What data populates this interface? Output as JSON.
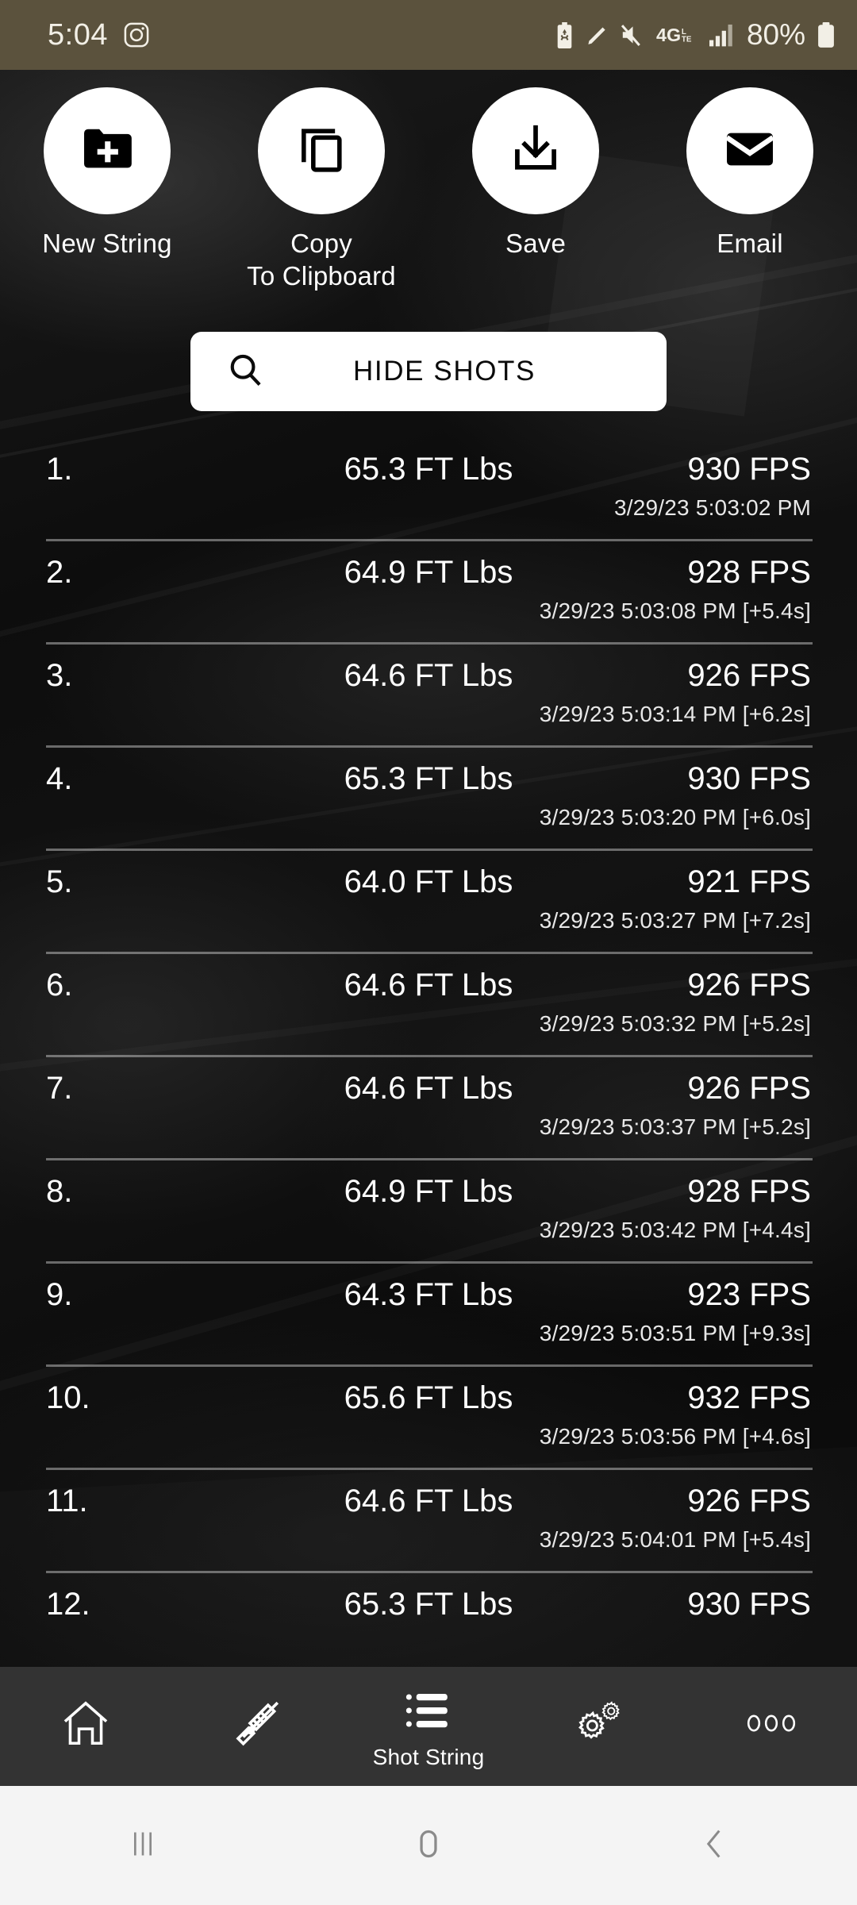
{
  "status_bar": {
    "time": "5:04",
    "battery_percent": "80%",
    "background_color": "#5b523d",
    "icons_left": [
      "instagram-icon"
    ],
    "icons_right": [
      "battery-saver-icon",
      "pencil-icon",
      "mute-icon",
      "4g-lte-icon",
      "signal-bars-icon",
      "battery-icon"
    ],
    "network": "4G",
    "network_sub": "LTE"
  },
  "actions": [
    {
      "label": "New String",
      "icon": "new-folder-icon"
    },
    {
      "label": "Copy\nTo Clipboard",
      "icon": "copy-icon"
    },
    {
      "label": "Save",
      "icon": "download-icon"
    },
    {
      "label": "Email",
      "icon": "envelope-icon"
    }
  ],
  "hide_shots": {
    "label": "HIDE SHOTS",
    "icon": "search-icon"
  },
  "shot_list": {
    "energy_unit": "FT Lbs",
    "speed_unit": "FPS",
    "rows": [
      {
        "index": "1.",
        "energy": "65.3 FT Lbs",
        "speed": "930 FPS",
        "timestamp": "3/29/23 5:03:02 PM"
      },
      {
        "index": "2.",
        "energy": "64.9 FT Lbs",
        "speed": "928 FPS",
        "timestamp": "3/29/23 5:03:08 PM [+5.4s]"
      },
      {
        "index": "3.",
        "energy": "64.6 FT Lbs",
        "speed": "926 FPS",
        "timestamp": "3/29/23 5:03:14 PM [+6.2s]"
      },
      {
        "index": "4.",
        "energy": "65.3 FT Lbs",
        "speed": "930 FPS",
        "timestamp": "3/29/23 5:03:20 PM [+6.0s]"
      },
      {
        "index": "5.",
        "energy": "64.0 FT Lbs",
        "speed": "921 FPS",
        "timestamp": "3/29/23 5:03:27 PM [+7.2s]"
      },
      {
        "index": "6.",
        "energy": "64.6 FT Lbs",
        "speed": "926 FPS",
        "timestamp": "3/29/23 5:03:32 PM [+5.2s]"
      },
      {
        "index": "7.",
        "energy": "64.6 FT Lbs",
        "speed": "926 FPS",
        "timestamp": "3/29/23 5:03:37 PM [+5.2s]"
      },
      {
        "index": "8.",
        "energy": "64.9 FT Lbs",
        "speed": "928 FPS",
        "timestamp": "3/29/23 5:03:42 PM [+4.4s]"
      },
      {
        "index": "9.",
        "energy": "64.3 FT Lbs",
        "speed": "923 FPS",
        "timestamp": "3/29/23 5:03:51 PM [+9.3s]"
      },
      {
        "index": "10.",
        "energy": "65.6 FT Lbs",
        "speed": "932 FPS",
        "timestamp": "3/29/23 5:03:56 PM [+4.6s]"
      },
      {
        "index": "11.",
        "energy": "64.6 FT Lbs",
        "speed": "926 FPS",
        "timestamp": "3/29/23 5:04:01 PM [+5.4s]"
      },
      {
        "index": "12.",
        "energy": "65.3 FT Lbs",
        "speed": "930 FPS",
        "timestamp": ""
      }
    ]
  },
  "bottom_nav": {
    "background_color": "#333333",
    "items": [
      {
        "label": "",
        "icon": "home-icon",
        "active": false
      },
      {
        "label": "",
        "icon": "rifle-icon",
        "active": false
      },
      {
        "label": "Shot String",
        "icon": "list-icon",
        "active": true
      },
      {
        "label": "",
        "icon": "gears-icon",
        "active": false
      },
      {
        "label": "",
        "icon": "more-dots-icon",
        "active": false
      }
    ]
  },
  "system_nav": {
    "background_color": "#f4f4f4",
    "items": [
      {
        "icon": "recents-icon"
      },
      {
        "icon": "home-pill-icon"
      },
      {
        "icon": "back-icon"
      }
    ]
  }
}
